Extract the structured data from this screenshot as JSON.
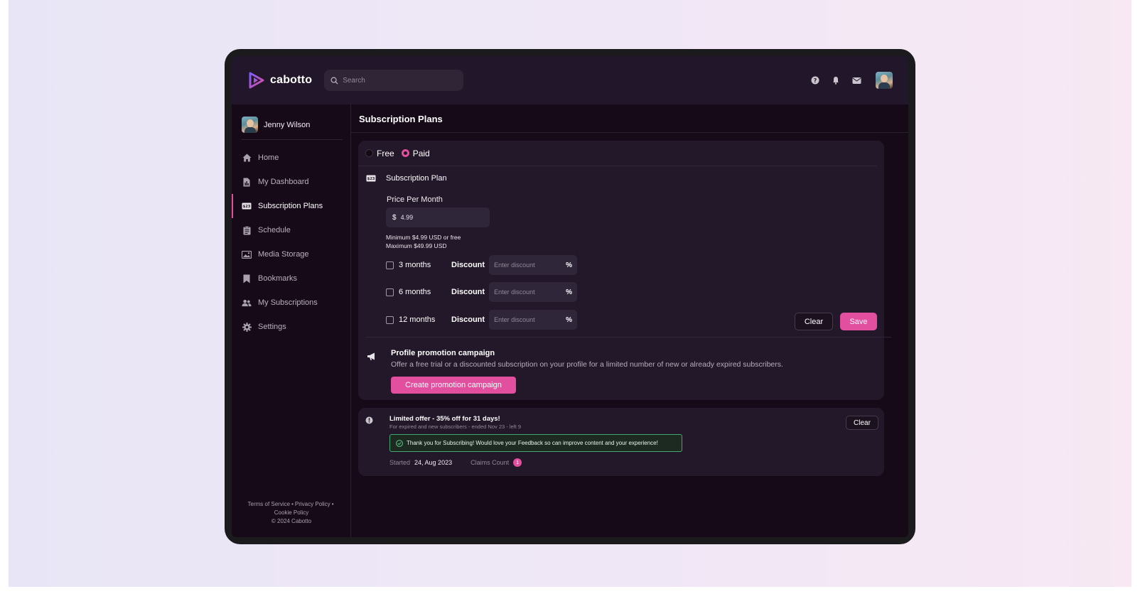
{
  "header": {
    "brand": "cabotto",
    "search_placeholder": "Search",
    "icons": [
      "help-icon",
      "bell-icon",
      "mail-icon"
    ]
  },
  "sidebar": {
    "user_name": "Jenny Wilson",
    "items": [
      {
        "label": "Home",
        "icon": "home-icon"
      },
      {
        "label": "My Dashboard",
        "icon": "dashboard-icon"
      },
      {
        "label": "Subscription Plans",
        "icon": "subscription-icon",
        "active": true
      },
      {
        "label": "Schedule",
        "icon": "schedule-icon"
      },
      {
        "label": "Media Storage",
        "icon": "media-icon"
      },
      {
        "label": "Bookmarks",
        "icon": "bookmark-icon"
      },
      {
        "label": "My Subscriptions",
        "icon": "users-icon"
      },
      {
        "label": "Settings",
        "icon": "gear-icon"
      }
    ],
    "footer": {
      "terms": "Terms of Service",
      "privacy": "Privacy Policy",
      "cookie": "Cookie Policy",
      "copyright": "© 2024 Cabotto"
    }
  },
  "main": {
    "page_title": "Subscription Plans",
    "plan_types": [
      {
        "label": "Free",
        "selected": false
      },
      {
        "label": "Paid",
        "selected": true
      }
    ],
    "section_title": "Subscription Plan",
    "price_label": "Price Per Month",
    "currency": "$",
    "price_value": "4.99",
    "hint_min": "Minimum $4.99 USD or free",
    "hint_max": "Maximum $49.99 USD",
    "terms": [
      {
        "label": "3 months",
        "checked": false
      },
      {
        "label": "6 months",
        "checked": false
      },
      {
        "label": "12 months",
        "checked": false
      }
    ],
    "discount_label": "Discount",
    "discount_placeholder": "Enter discount",
    "percent": "%",
    "clear_label": "Clear",
    "save_label": "Save",
    "promo": {
      "title": "Profile promotion campaign",
      "description": "Offer a free trial or a discounted subscription on your profile for a limited number of new or already expired subscribers.",
      "button": "Create promotion campaign"
    },
    "offer": {
      "title": "Limited offer - 35% off for 31 days!",
      "subtitle": "For expired and new subscribers - ended Nov 23 - left 9",
      "message": "Thank you for Subscribing! Would love your Feedback so can improve content and your experience!",
      "started_label": "Started",
      "started_value": "24, Aug 2023",
      "claims_label": "Claims Count",
      "claims_value": "1",
      "clear_label": "Clear"
    }
  },
  "colors": {
    "accent": "#e24f9e",
    "success": "#3fa86b",
    "bg": "#160a18"
  }
}
